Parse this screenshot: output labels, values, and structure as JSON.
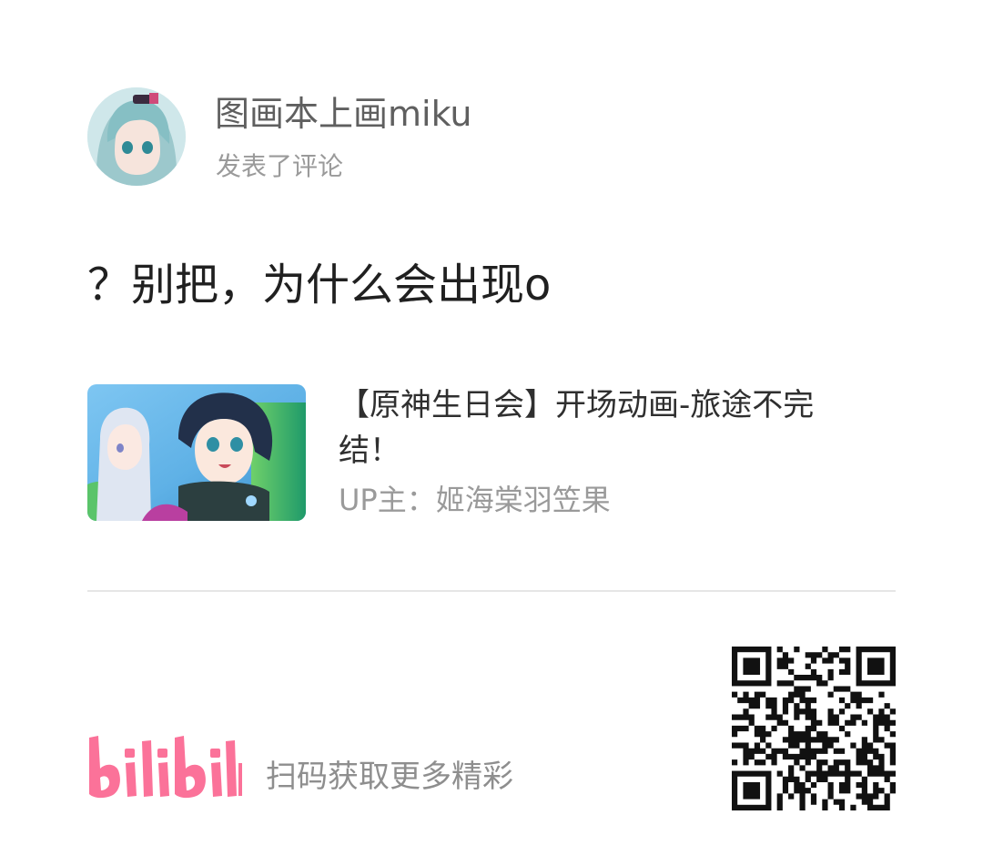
{
  "author": {
    "name": "图画本上画miku",
    "action": "发表了评论"
  },
  "comment": {
    "text": "？别把，为什么会出现o"
  },
  "video": {
    "title": "【原神生日会】开场动画-旅途不完结！",
    "up_line": "UP主：姬海棠羽笠果"
  },
  "footer": {
    "logo_text": "bilibili",
    "slogan": "扫码获取更多精彩"
  },
  "colors": {
    "brand_pink": "#fb7299",
    "text_primary": "#202020",
    "text_secondary": "#9a9a9a",
    "divider": "#e6e6e6"
  }
}
